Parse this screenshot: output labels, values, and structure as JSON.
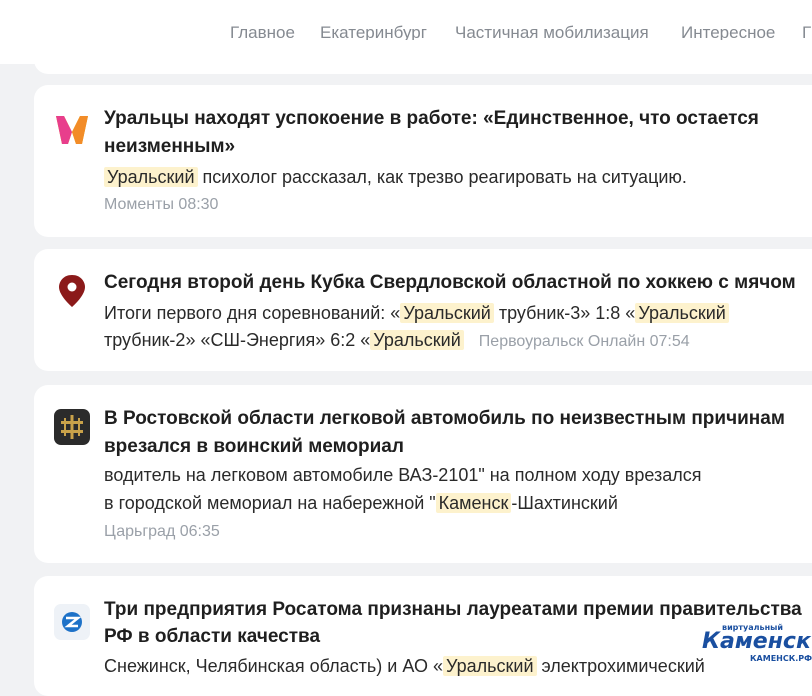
{
  "nav": {
    "items": [
      "Главное",
      "Екатеринбург",
      "Частичная мобилизация",
      "Интересное",
      "Г"
    ]
  },
  "news": [
    {
      "icon": "momenty-logo-icon",
      "title_line1": "Уральцы находят успокоение в работе: «Единственное, что остается",
      "title_line2": "неизменным»",
      "snippet": {
        "hl1": "Уральский",
        "text1": " психолог рассказал, как трезво реагировать на ситуацию."
      },
      "source_time": "Моменты 08:30"
    },
    {
      "icon": "map-pin-icon",
      "title_line1": "Сегодня второй день Кубка Свердловской областной по хоккею с мячом",
      "snippet": {
        "line1_pre": "Итоги первого дня соревнований: «",
        "line1_hl1": "Уральский",
        "line1_mid": " трубник-3» 1:8 «",
        "line1_hl2": "Уральский",
        "line2_pre": "трубник-2» «СШ-Энергия» 6:2 «",
        "line2_hl": "Уральский",
        "source_time": "Первоуральск Онлайн 07:54"
      }
    },
    {
      "icon": "tsargrad-cross-icon",
      "title_line1": "В Ростовской области легковой автомобиль по неизвестным причинам",
      "title_line2": "врезался в воинский мемориал",
      "snippet": {
        "line1": "водитель на легковом автомобиле ВАЗ-2101\" на полном ходу врезался",
        "line2_pre": "в городской мемориал на набережной \"",
        "line2_hl": "Каменск",
        "line2_post": "-Шахтинский"
      },
      "source_time": "Царьград 06:35"
    },
    {
      "icon": "rosatom-logo-icon",
      "title_line1": "Три предприятия Росатома признаны лауреатами премии правительства",
      "title_line2": "РФ в области качества",
      "snippet": {
        "pre": "Снежинск, Челябинская область) и АО «",
        "hl": "Уральский",
        "post": " электрохимический"
      }
    }
  ],
  "watermark": {
    "top": "виртуальный",
    "main": "Каменск",
    "bottom": "КАМЕНСК.РФ"
  }
}
